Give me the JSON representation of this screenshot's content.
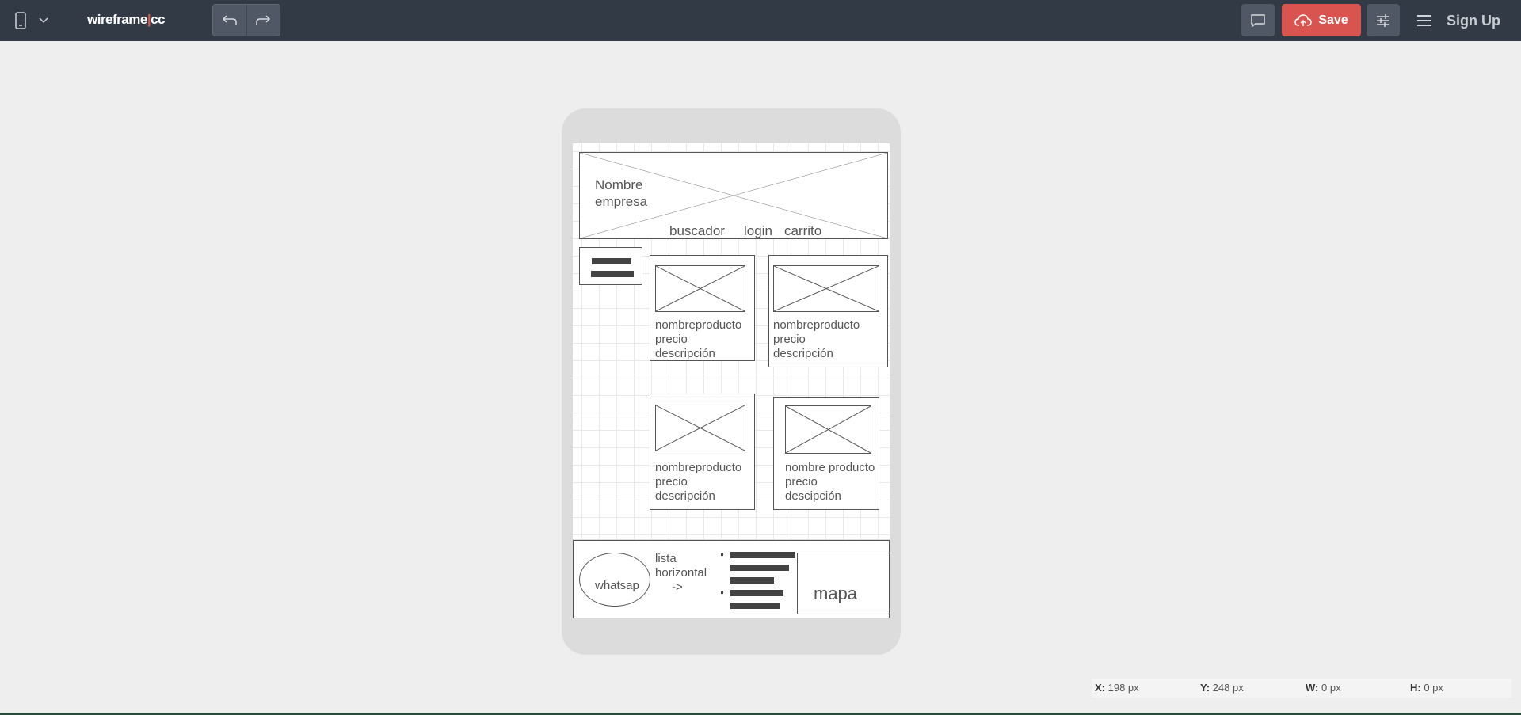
{
  "toolbar": {
    "device_icon": "phone-icon",
    "logo_left": "wireframe",
    "logo_sep": "|",
    "logo_right": "cc",
    "undo_icon": "undo-icon",
    "redo_icon": "redo-icon",
    "comment_icon": "comment-icon",
    "save_label": "Save",
    "settings_icon": "sliders-icon",
    "menu_icon": "hamburger-icon",
    "signup_label": "Sign Up",
    "save_color": "#d9534f",
    "bar_color": "#323a46"
  },
  "canvas": {
    "header_title": "Nombre\nempresa",
    "header_links": [
      "buscador",
      "login",
      "carrito"
    ],
    "products": [
      {
        "lines": [
          "nombreproducto",
          "precio",
          "descripción"
        ]
      },
      {
        "lines": [
          "nombreproducto",
          "precio",
          "descripción"
        ]
      },
      {
        "lines": [
          "nombreproducto",
          "precio",
          "descripción"
        ]
      },
      {
        "lines": [
          "nombre producto",
          "precio",
          "descipción"
        ]
      }
    ],
    "footer": {
      "whatsapp": "whatsap",
      "list_lines": [
        "lista",
        "horizontal",
        "->"
      ],
      "map": "mapa"
    }
  },
  "status": {
    "x_label": "X:",
    "x_value": "198 px",
    "y_label": "Y:",
    "y_value": "248 px",
    "w_label": "W:",
    "w_value": "0 px",
    "h_label": "H:",
    "h_value": "0 px"
  }
}
